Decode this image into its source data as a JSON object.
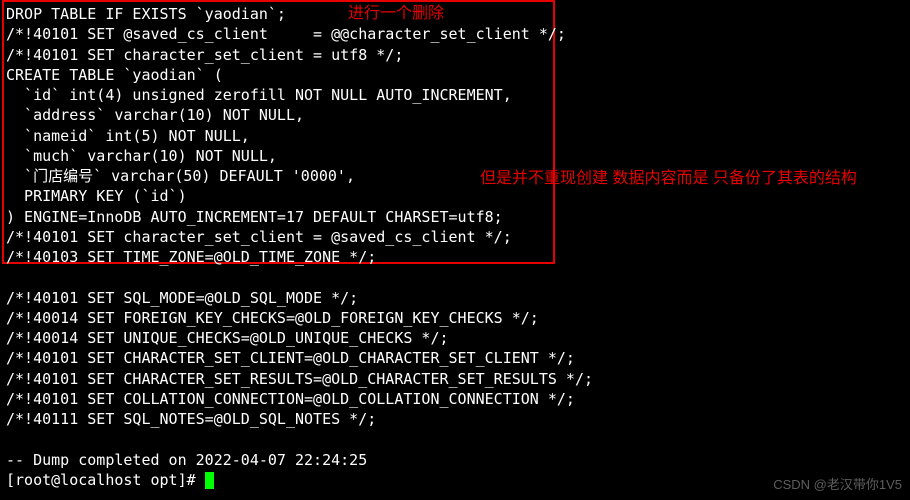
{
  "annotations": {
    "top": "进行一个删除",
    "right": "但是并不重现创建 数据内容而是 只备份了其表的结构"
  },
  "sql": {
    "l01": "DROP TABLE IF EXISTS `yaodian`;",
    "l02": "/*!40101 SET @saved_cs_client     = @@character_set_client */;",
    "l03": "/*!40101 SET character_set_client = utf8 */;",
    "l04": "CREATE TABLE `yaodian` (",
    "l05": "  `id` int(4) unsigned zerofill NOT NULL AUTO_INCREMENT,",
    "l06": "  `address` varchar(10) NOT NULL,",
    "l07": "  `nameid` int(5) NOT NULL,",
    "l08": "  `much` varchar(10) NOT NULL,",
    "l09": "  `门店编号` varchar(50) DEFAULT '0000',",
    "l10": "  PRIMARY KEY (`id`)",
    "l11": ") ENGINE=InnoDB AUTO_INCREMENT=17 DEFAULT CHARSET=utf8;",
    "l12": "/*!40101 SET character_set_client = @saved_cs_client */;",
    "l13": "/*!40103 SET TIME_ZONE=@OLD_TIME_ZONE */;",
    "l14": "",
    "l15": "/*!40101 SET SQL_MODE=@OLD_SQL_MODE */;",
    "l16": "/*!40014 SET FOREIGN_KEY_CHECKS=@OLD_FOREIGN_KEY_CHECKS */;",
    "l17": "/*!40014 SET UNIQUE_CHECKS=@OLD_UNIQUE_CHECKS */;",
    "l18": "/*!40101 SET CHARACTER_SET_CLIENT=@OLD_CHARACTER_SET_CLIENT */;",
    "l19": "/*!40101 SET CHARACTER_SET_RESULTS=@OLD_CHARACTER_SET_RESULTS */;",
    "l20": "/*!40101 SET COLLATION_CONNECTION=@OLD_COLLATION_CONNECTION */;",
    "l21": "/*!40111 SET SQL_NOTES=@OLD_SQL_NOTES */;",
    "l22": "",
    "l23": "-- Dump completed on 2022-04-07 22:24:25"
  },
  "prompt": "[root@localhost opt]# ",
  "watermark": "CSDN @老汉带你1V5"
}
